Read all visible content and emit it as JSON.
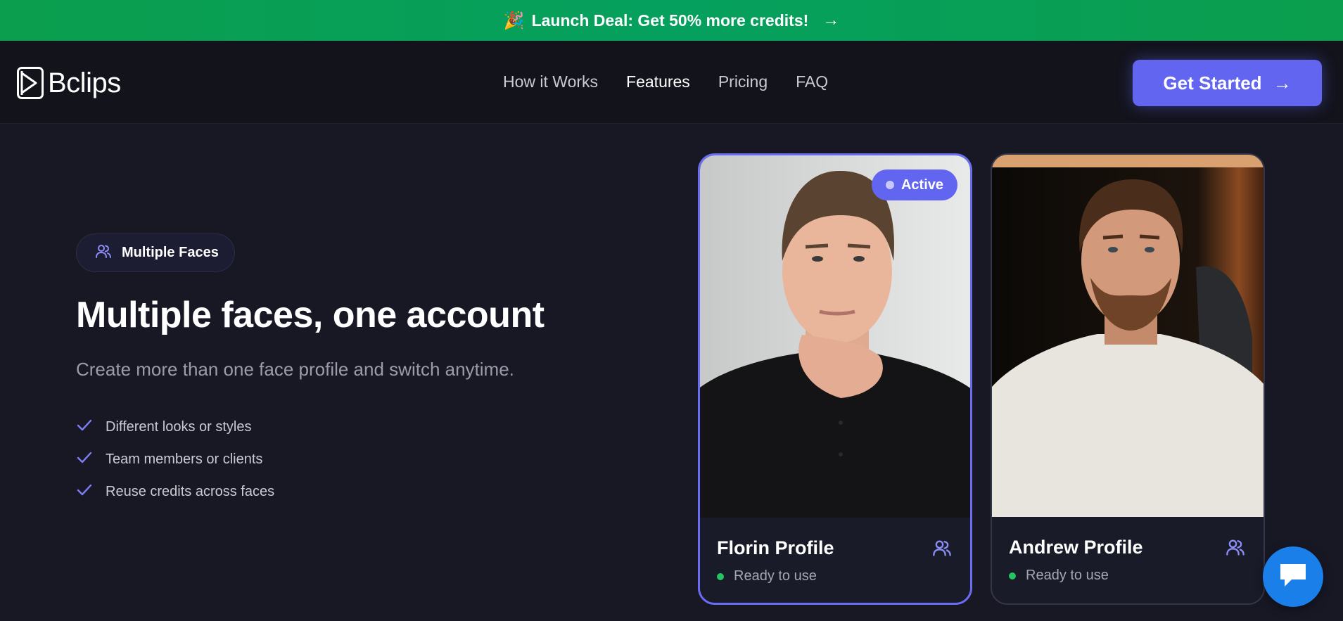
{
  "promo": {
    "emoji": "🎉",
    "text": "Launch Deal: Get 50% more credits!",
    "arrow": "→"
  },
  "header": {
    "logo_text": "Bclips",
    "nav": [
      {
        "label": "How it Works"
      },
      {
        "label": "Features"
      },
      {
        "label": "Pricing"
      },
      {
        "label": "FAQ"
      }
    ],
    "cta_label": "Get Started",
    "cta_arrow": "→"
  },
  "hero": {
    "badge": "Multiple Faces",
    "title": "Multiple faces, one account",
    "subtitle": "Create more than one face profile and switch anytime.",
    "checklist": [
      "Different looks or styles",
      "Team members or clients",
      "Reuse credits across faces"
    ]
  },
  "profiles": [
    {
      "name": "Florin Profile",
      "status": "Ready to use",
      "badge": "Active"
    },
    {
      "name": "Andrew Profile",
      "status": "Ready to use"
    }
  ],
  "colors": {
    "accent": "#6265f0",
    "promo_green": "#05a05e",
    "status_green": "#22c55e",
    "background": "#171824",
    "chat_blue": "#1a7fe8"
  },
  "icons": [
    "party-popper-icon",
    "arrow-right-icon",
    "people-icon",
    "check-icon",
    "chat-icon"
  ]
}
